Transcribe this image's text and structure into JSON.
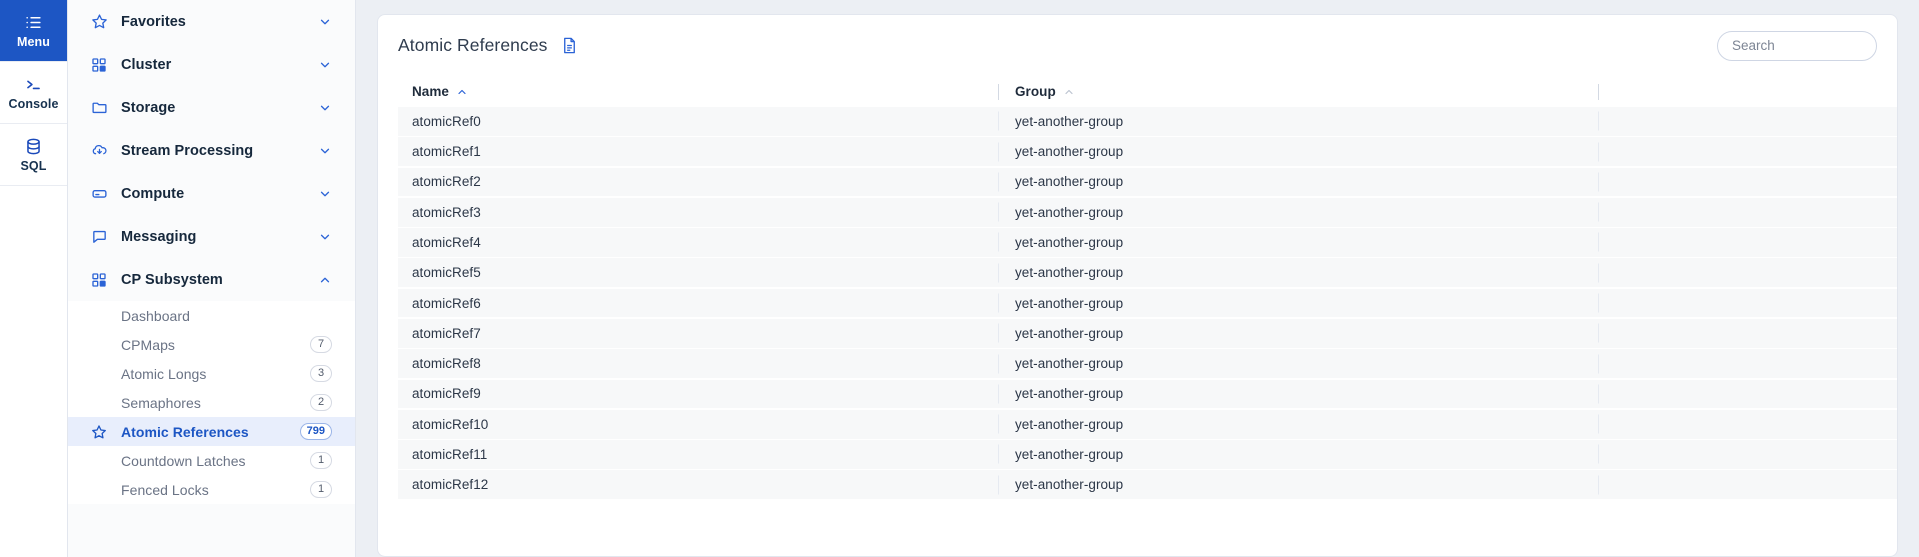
{
  "rail": {
    "items": [
      {
        "label": "Menu",
        "icon": "menu-list-icon",
        "active": true
      },
      {
        "label": "Console",
        "icon": "terminal-icon",
        "active": false
      },
      {
        "label": "SQL",
        "icon": "database-icon",
        "active": false
      }
    ]
  },
  "sidebar": {
    "groups": [
      {
        "label": "Favorites",
        "icon": "star-icon",
        "expanded": false
      },
      {
        "label": "Cluster",
        "icon": "grid-icon",
        "expanded": false
      },
      {
        "label": "Storage",
        "icon": "folder-icon",
        "expanded": false
      },
      {
        "label": "Stream Processing",
        "icon": "stream-icon",
        "expanded": false
      },
      {
        "label": "Compute",
        "icon": "server-icon",
        "expanded": false
      },
      {
        "label": "Messaging",
        "icon": "chat-icon",
        "expanded": false
      },
      {
        "label": "CP Subsystem",
        "icon": "grid-icon",
        "expanded": true
      }
    ],
    "cp_subsystem_items": [
      {
        "label": "Dashboard",
        "badge": "",
        "selected": false,
        "star": false
      },
      {
        "label": "CPMaps",
        "badge": "7",
        "selected": false,
        "star": false
      },
      {
        "label": "Atomic Longs",
        "badge": "3",
        "selected": false,
        "star": false
      },
      {
        "label": "Semaphores",
        "badge": "2",
        "selected": false,
        "star": false
      },
      {
        "label": "Atomic References",
        "badge": "799",
        "selected": true,
        "star": true
      },
      {
        "label": "Countdown Latches",
        "badge": "1",
        "selected": false,
        "star": false
      },
      {
        "label": "Fenced Locks",
        "badge": "1",
        "selected": false,
        "star": false
      }
    ]
  },
  "main": {
    "title": "Atomic References",
    "title_icon": "document-icon",
    "search": {
      "value": "",
      "placeholder": "Search",
      "icon": "search-icon"
    },
    "table": {
      "columns": [
        {
          "label": "Name",
          "sort": "asc",
          "sort_active": true
        },
        {
          "label": "Group",
          "sort": "asc",
          "sort_active": false
        }
      ],
      "rows": [
        {
          "name": "atomicRef0",
          "group": "yet-another-group"
        },
        {
          "name": "atomicRef1",
          "group": "yet-another-group"
        },
        {
          "name": "atomicRef2",
          "group": "yet-another-group"
        },
        {
          "name": "atomicRef3",
          "group": "yet-another-group"
        },
        {
          "name": "atomicRef4",
          "group": "yet-another-group"
        },
        {
          "name": "atomicRef5",
          "group": "yet-another-group"
        },
        {
          "name": "atomicRef6",
          "group": "yet-another-group"
        },
        {
          "name": "atomicRef7",
          "group": "yet-another-group"
        },
        {
          "name": "atomicRef8",
          "group": "yet-another-group"
        },
        {
          "name": "atomicRef9",
          "group": "yet-another-group"
        },
        {
          "name": "atomicRef10",
          "group": "yet-another-group"
        },
        {
          "name": "atomicRef11",
          "group": "yet-another-group"
        },
        {
          "name": "atomicRef12",
          "group": "yet-another-group"
        }
      ]
    }
  },
  "colors": {
    "accent": "#1d56c4",
    "accent_light": "#2b63d6",
    "selected_row_bg": "#e8eefc",
    "page_bg": "#eceff4",
    "row_bg": "#f7f8f9"
  }
}
